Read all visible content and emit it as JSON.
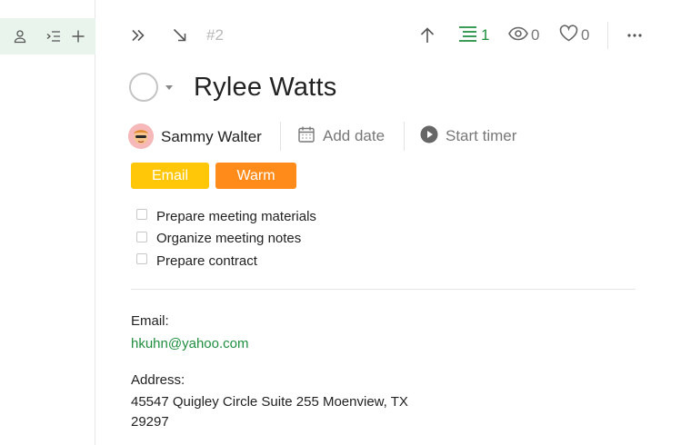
{
  "topbar": {
    "task_number": "#2",
    "subtasks_count": "1",
    "watchers_count": "0",
    "likes_count": "0"
  },
  "task": {
    "title": "Rylee Watts",
    "assignee": "Sammy Walter",
    "add_date_label": "Add date",
    "start_timer_label": "Start timer",
    "tags": [
      {
        "label": "Email",
        "color": "#ffc708"
      },
      {
        "label": "Warm",
        "color": "#ff8c1a"
      }
    ],
    "checklist": [
      {
        "label": "Prepare meeting materials",
        "checked": false
      },
      {
        "label": "Organize meeting notes",
        "checked": false
      },
      {
        "label": "Prepare contract",
        "checked": false
      }
    ],
    "fields": {
      "email_label": "Email:",
      "email_value": "hkuhn@yahoo.com",
      "address_label": "Address:",
      "address_line1": "45547 Quigley Circle Suite 255 Moenview, TX",
      "address_line2": "29297"
    }
  },
  "colors": {
    "accent_green": "#1e8e3e",
    "rail_highlight": "#e9f5ec"
  },
  "icons": {
    "rail": [
      "user-icon",
      "indent-list-icon",
      "plus-icon"
    ],
    "topbar": [
      "double-chevron-right-icon",
      "collapse-arrow-icon",
      "arrow-up-icon",
      "subtasks-list-icon",
      "eye-icon",
      "heart-icon",
      "more-horizontal-icon"
    ],
    "meta": [
      "calendar-icon",
      "play-circle-icon"
    ]
  }
}
